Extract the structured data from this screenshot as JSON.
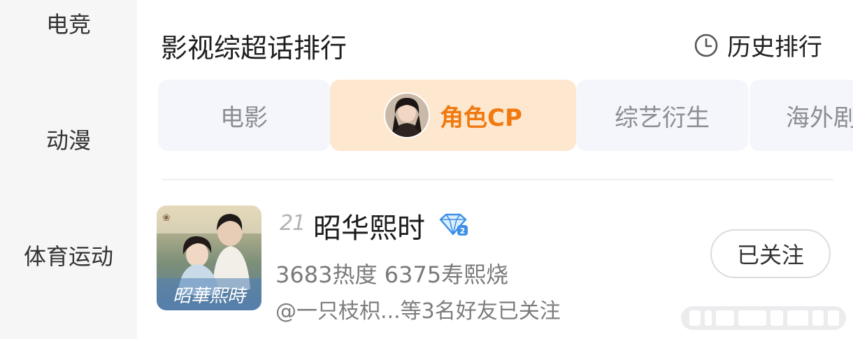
{
  "sidebar": {
    "items": [
      {
        "label": "电竞"
      },
      {
        "label": "动漫"
      },
      {
        "label": "体育运动"
      }
    ]
  },
  "header": {
    "title": "影视综超话排行",
    "history_label": "历史排行"
  },
  "tabs": [
    {
      "label": "电影",
      "active": false
    },
    {
      "label": "角色CP",
      "active": true
    },
    {
      "label": "综艺衍生",
      "active": false
    },
    {
      "label": "海外剧",
      "active": false
    }
  ],
  "list": {
    "items": [
      {
        "rank": "21",
        "name": "昭华熙时",
        "poster_text": "昭華熙時",
        "stats": "3683热度 6375寿熙烧",
        "friends": "@一只枝枳...等3名好友已关注",
        "follow_label": "已关注"
      }
    ]
  },
  "colors": {
    "accent": "#f07a10",
    "active_tab_bg": "#fde7cf",
    "tab_bg": "#f4f6fb",
    "sidebar_bg": "#f6f6f7"
  }
}
